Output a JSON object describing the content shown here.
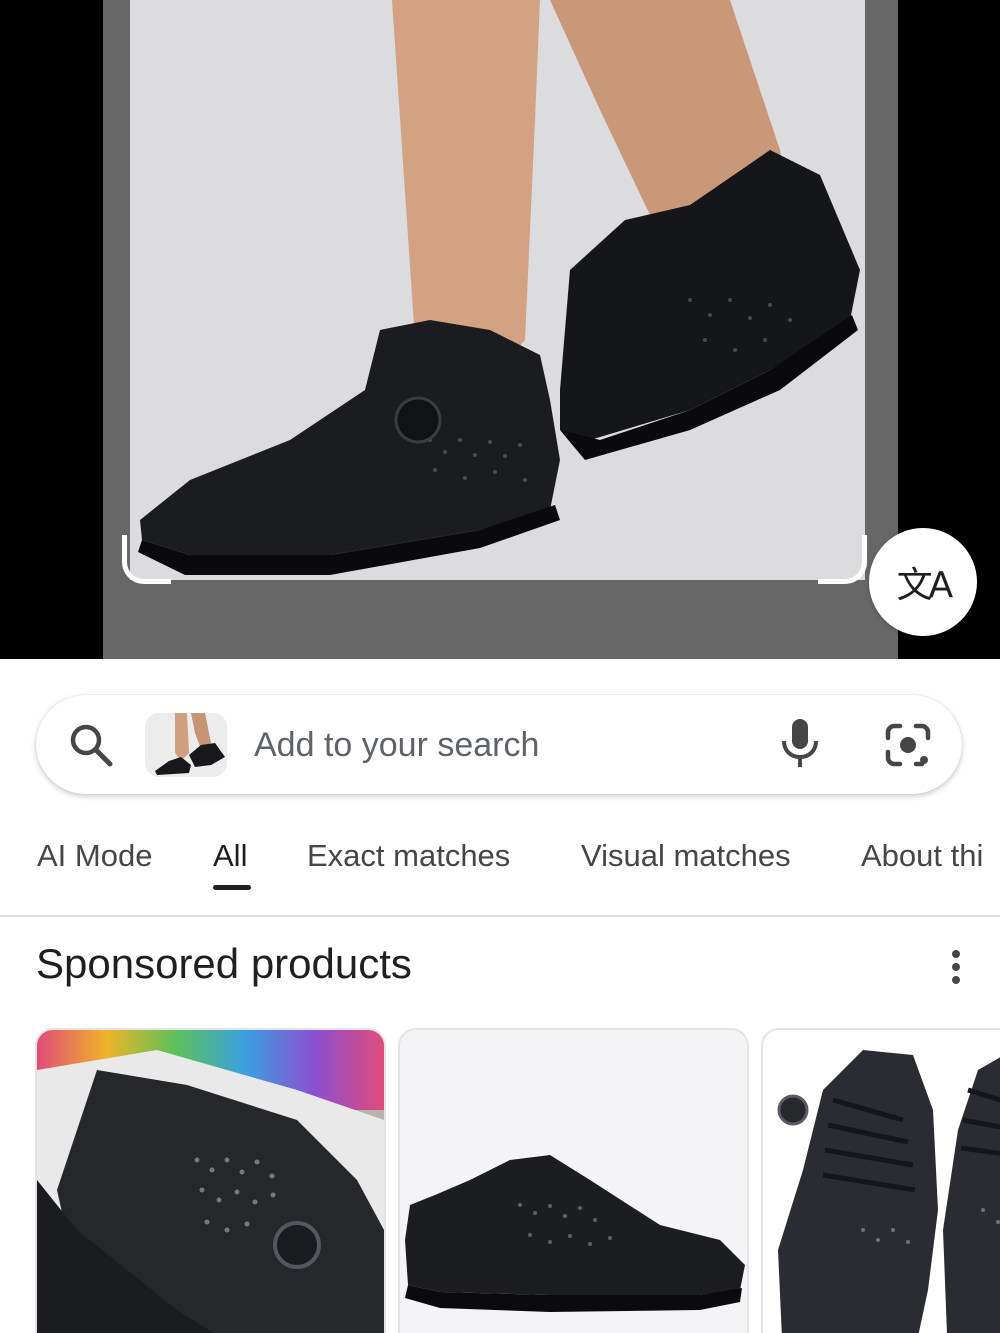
{
  "viewer": {
    "translate_button_glyph": "文A"
  },
  "search": {
    "placeholder": "Add to your search",
    "value": ""
  },
  "tabs": [
    {
      "label": "AI Mode"
    },
    {
      "label": "All"
    },
    {
      "label": "Exact matches"
    },
    {
      "label": "Visual matches"
    },
    {
      "label": "About thi"
    }
  ],
  "active_tab": "All",
  "sponsored": {
    "title": "Sponsored products",
    "products": [
      {
        "image": "black-rhinestone-sneaker-on-tissue-paper"
      },
      {
        "image": "black-crystal-embellished-sneaker-side-view"
      },
      {
        "image": "pair-of-black-crystal-sneakers-top-view"
      }
    ]
  },
  "colors": {
    "viewer_bg": "#000000",
    "photo_frame": "#676767",
    "photo_bg": "#dcdcdf",
    "text_primary": "#1f1f1f",
    "text_secondary": "#444746",
    "divider": "#dadce0"
  },
  "icons": [
    "search-icon",
    "microphone-icon",
    "camera-lens-icon",
    "translate-icon",
    "more-vertical-icon"
  ]
}
